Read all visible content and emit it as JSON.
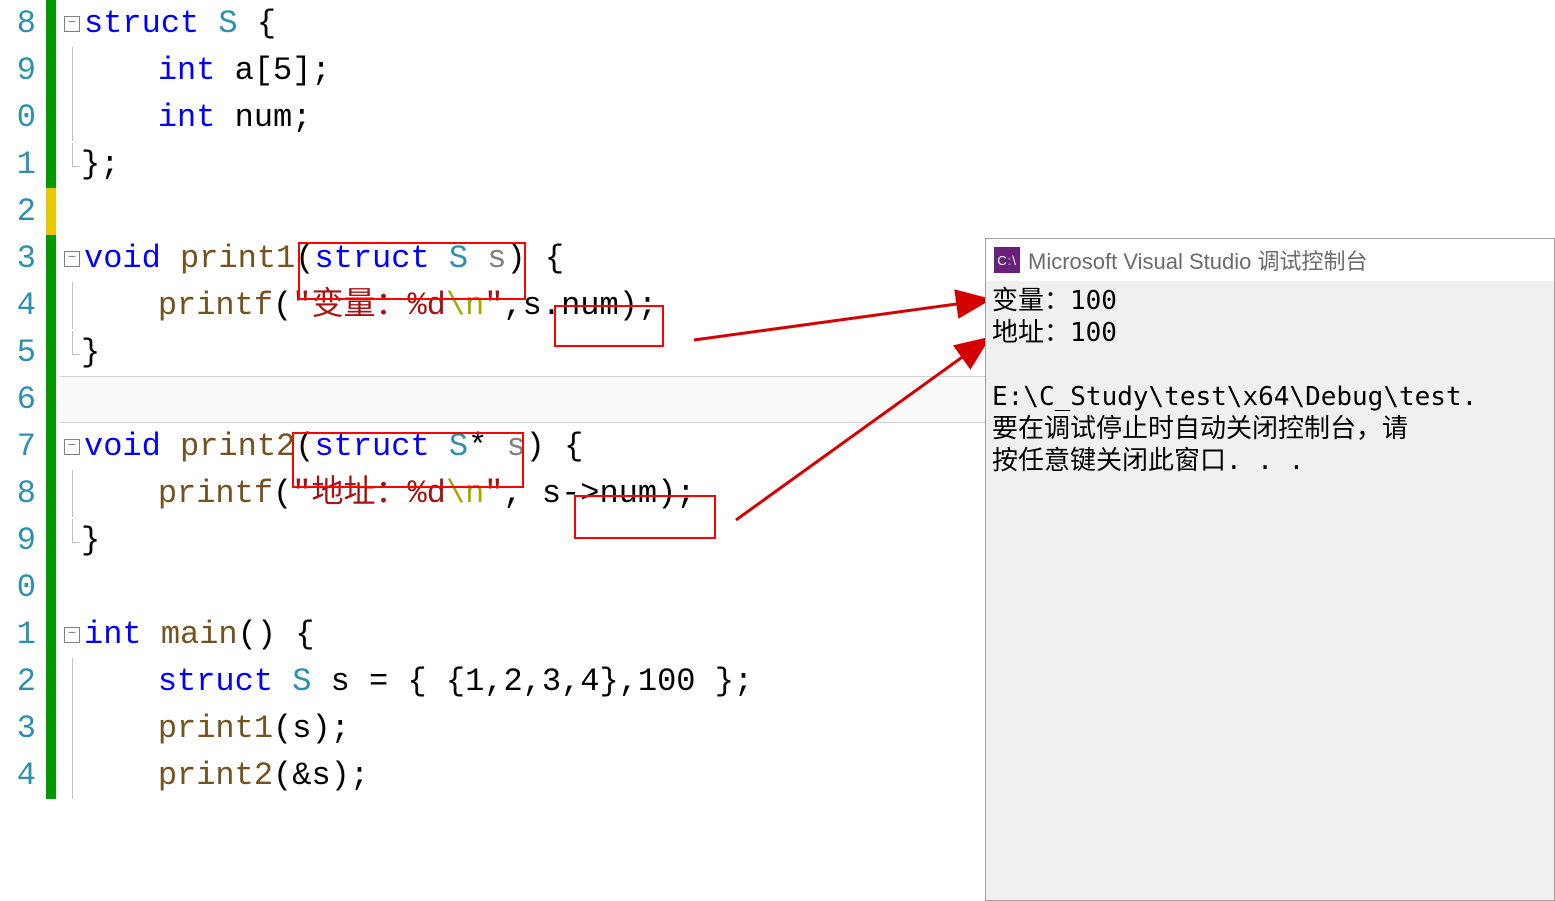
{
  "gutter": [
    "8",
    "9",
    "0",
    "1",
    "2",
    "3",
    "4",
    "5",
    "6",
    "7",
    "8",
    "9",
    "0",
    "1",
    "2",
    "3",
    "4"
  ],
  "code": {
    "l0": {
      "kw1": "struct",
      "type": "S",
      "rest": " {"
    },
    "l1": {
      "kw": "int",
      "rest": " a[5];"
    },
    "l2": {
      "kw": "int",
      "rest": " num;"
    },
    "l3": {
      "rest": "};"
    },
    "l5": {
      "kw1": "void",
      "func": "print1",
      "open": "(",
      "kw2": "struct",
      "type": "S",
      "param": "s",
      "close": ")",
      "rest": " {"
    },
    "l6": {
      "func": "printf",
      "open": "(",
      "s_open": "\"",
      "s_txt": "变量：%d",
      "s_esc": "\\n",
      "s_close": "\"",
      "comma": ",",
      "mem": "s.num",
      "close": ")",
      "semi": ";"
    },
    "l7": {
      "rest": "}"
    },
    "l9": {
      "kw1": "void",
      "func": "print2",
      "open": "(",
      "kw2": "struct",
      "type": "S",
      "star": "*",
      "param": "s",
      "close": ")",
      "rest": " {"
    },
    "l10": {
      "func": "printf",
      "open": "(",
      "s_open": "\"",
      "s_txt": "地址：%d",
      "s_esc": "\\n",
      "s_close": "\"",
      "comma": ",",
      "mem": "s->num",
      "close": ")",
      "semi": ";"
    },
    "l11": {
      "rest": "}"
    },
    "l13": {
      "kw1": "int",
      "func": "main",
      "rest": "() {"
    },
    "l14": {
      "kw": "struct",
      "type": "S",
      "rest": " s = { {1,2,3,4},100 };"
    },
    "l15": {
      "func": "print1",
      "rest": "(s);"
    },
    "l16": {
      "func": "print2",
      "rest": "(&s);"
    }
  },
  "console": {
    "title": "Microsoft Visual Studio 调试控制台",
    "icon": "C:\\",
    "out1": "变量：100",
    "out2": "地址：100",
    "out3": "",
    "out4": "E:\\C_Study\\test\\x64\\Debug\\test.",
    "out5": "要在调试停止时自动关闭控制台，请",
    "out6": "按任意键关闭此窗口. . ."
  }
}
